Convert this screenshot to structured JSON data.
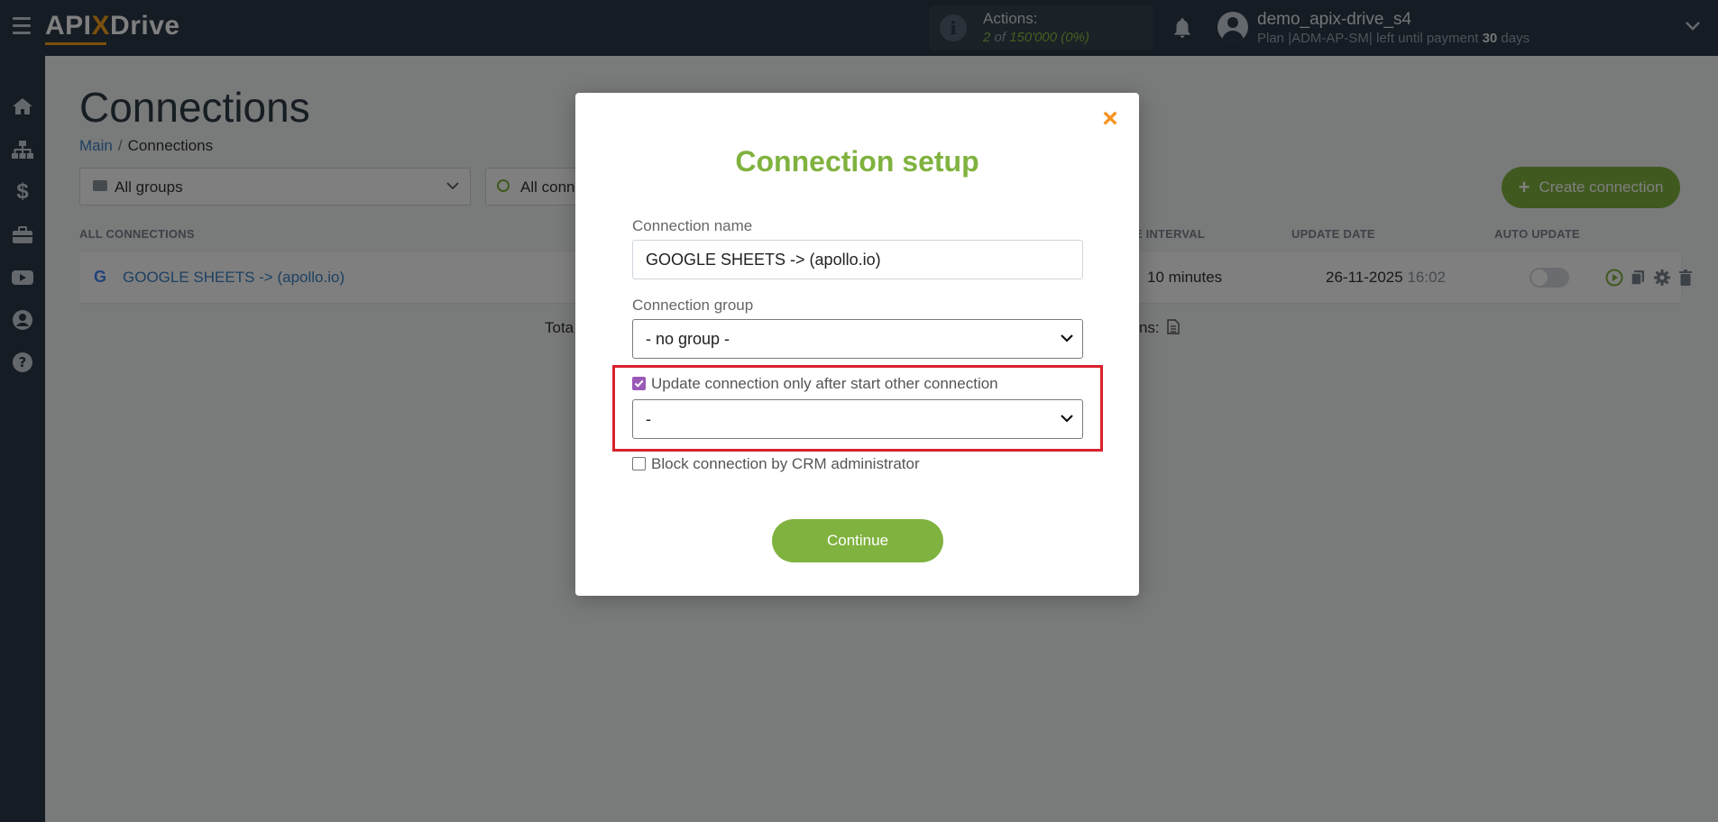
{
  "app": {
    "logo_api": "API",
    "logo_x": "X",
    "logo_drive": "Drive"
  },
  "header": {
    "actions_title": "Actions:",
    "actions_used": "2",
    "actions_of": "of",
    "actions_total": "150'000",
    "actions_percent": "(0%)",
    "username": "demo_apix-drive_s4",
    "plan_prefix": "Plan |ADM-AP-SM| left until payment",
    "plan_days": "30",
    "plan_suffix": "days"
  },
  "sidebar": {
    "items": [
      "home-icon",
      "sitemap-icon",
      "dollar-icon",
      "briefcase-icon",
      "youtube-icon",
      "user-icon",
      "help-icon"
    ]
  },
  "page": {
    "title": "Connections",
    "breadcrumb": {
      "home": "Main",
      "separator": "/",
      "current": "Connections"
    },
    "filter_groups": "All groups",
    "filter_status": "All connections",
    "create_button": "Create connection",
    "columns": {
      "all": "ALL CONNECTIONS",
      "interval": "UPDATE INTERVAL",
      "date": "UPDATE DATE",
      "auto": "AUTO UPDATE"
    },
    "rows": [
      {
        "name": "GOOGLE SHEETS -> (apollo.io)",
        "interval": "10 minutes",
        "date": "26-11-2025",
        "time": "16:02",
        "auto_update": false
      }
    ],
    "total_left": "Tota",
    "total_right": "tions:"
  },
  "modal": {
    "title": "Connection setup",
    "close_symbol": "×",
    "name_label": "Connection name",
    "name_value": "GOOGLE SHEETS -> (apollo.io)",
    "group_label": "Connection group",
    "group_value": "- no group -",
    "update_after_label": "Update connection only after start other connection",
    "update_after_checked": true,
    "update_after_value": "-",
    "block_label": "Block connection by CRM administrator",
    "block_checked": false,
    "continue_label": "Continue"
  },
  "colors": {
    "accent": "#80b23f",
    "header": "#2b3847",
    "close": "#f7931e",
    "highlight": "#d9212c",
    "link": "#3c82c4"
  }
}
